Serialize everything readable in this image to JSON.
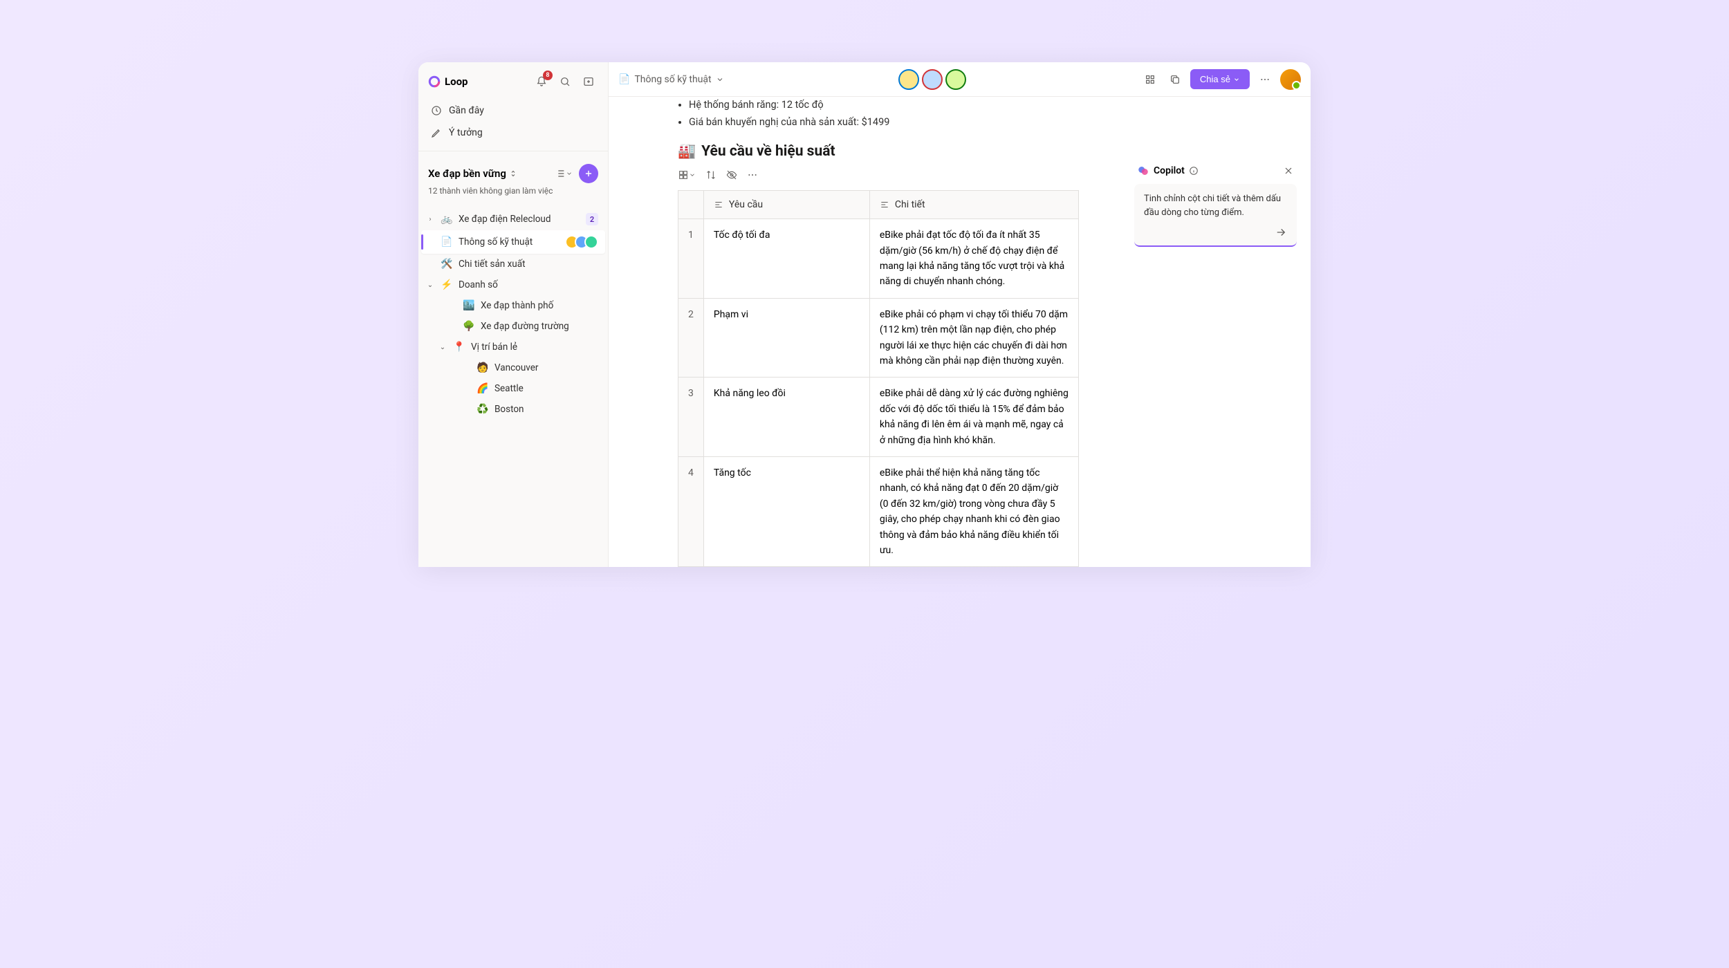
{
  "app": {
    "name": "Loop"
  },
  "notifications": {
    "count": "8"
  },
  "nav": {
    "recent": "Gần đây",
    "ideas": "Ý tưởng"
  },
  "workspace": {
    "name": "Xe đạp bền vững",
    "members_label": "12 thành viên không gian làm việc"
  },
  "tree": {
    "items": [
      {
        "chev": "›",
        "emoji": "🚲",
        "label": "Xe đạp điện Relecloud",
        "badge": "2"
      },
      {
        "emoji": "📄",
        "label": "Thông số kỹ thuật",
        "active": true,
        "avatars": true
      },
      {
        "emoji": "🛠️",
        "label": "Chi tiết sản xuất"
      },
      {
        "chev": "⌄",
        "emoji": "⚡",
        "label": "Doanh số"
      },
      {
        "emoji": "🏙️",
        "label": "Xe đạp thành phố",
        "indent": 2
      },
      {
        "emoji": "🌳",
        "label": "Xe đạp đường trường",
        "indent": 2
      },
      {
        "chev": "⌄",
        "emoji": "📍",
        "label": "Vị trí bán lẻ",
        "indent": 1
      },
      {
        "emoji": "🧑",
        "label": "Vancouver",
        "indent": 3
      },
      {
        "emoji": "🌈",
        "label": "Seattle",
        "indent": 3
      },
      {
        "emoji": "♻️",
        "label": "Boston",
        "indent": 3
      }
    ]
  },
  "breadcrumb": {
    "icon": "📄",
    "title": "Thông số kỹ thuật"
  },
  "share_label": "Chia sẻ",
  "presence_colors": [
    "#0078d4",
    "#d13438",
    "#107c10"
  ],
  "doc": {
    "bullets": [
      "Hệ thống bánh răng: 12 tốc độ",
      "Giá bán khuyến nghị của nhà sản xuất: $1499"
    ],
    "heading_emoji": "🏭",
    "heading": "Yêu cầu về hiệu suất",
    "table": {
      "columns": [
        "Yêu cầu",
        "Chi tiết"
      ],
      "rows": [
        {
          "n": "1",
          "a": "Tốc độ tối đa",
          "b": "eBike phải đạt tốc độ tối đa ít nhất 35 dặm/giờ (56 km/h) ở chế độ chạy điện để mang lại khả năng tăng tốc vượt trội và khả năng di chuyển nhanh chóng."
        },
        {
          "n": "2",
          "a": "Phạm vi",
          "b": "eBike phải có phạm vi chạy tối thiểu 70 dặm (112 km) trên một lần nạp điện, cho phép người lái xe thực hiện các chuyến đi dài hơn mà không cần phải nạp điện thường xuyên."
        },
        {
          "n": "3",
          "a": "Khả năng leo đồi",
          "b": "eBike phải dễ dàng xử lý các đường nghiêng dốc với độ dốc tối thiểu là 15% để đảm bảo khả năng đi lên êm ái và mạnh mẽ, ngay cả ở những địa hình khó khăn."
        },
        {
          "n": "4",
          "a": "Tăng tốc",
          "b": "eBike phải thể hiện khả năng tăng tốc nhanh, có khả năng đạt 0 đến 20 dặm/giờ (0 đến 32 km/giờ) trong vòng chưa đầy 5 giây, cho phép chạy nhanh khi có đèn giao thông và đảm bảo khả năng điều khiển tối ưu."
        }
      ]
    }
  },
  "copilot": {
    "title": "Copilot",
    "prompt": "Tinh chỉnh cột chi tiết và thêm dấu đầu dòng cho từng điểm."
  }
}
